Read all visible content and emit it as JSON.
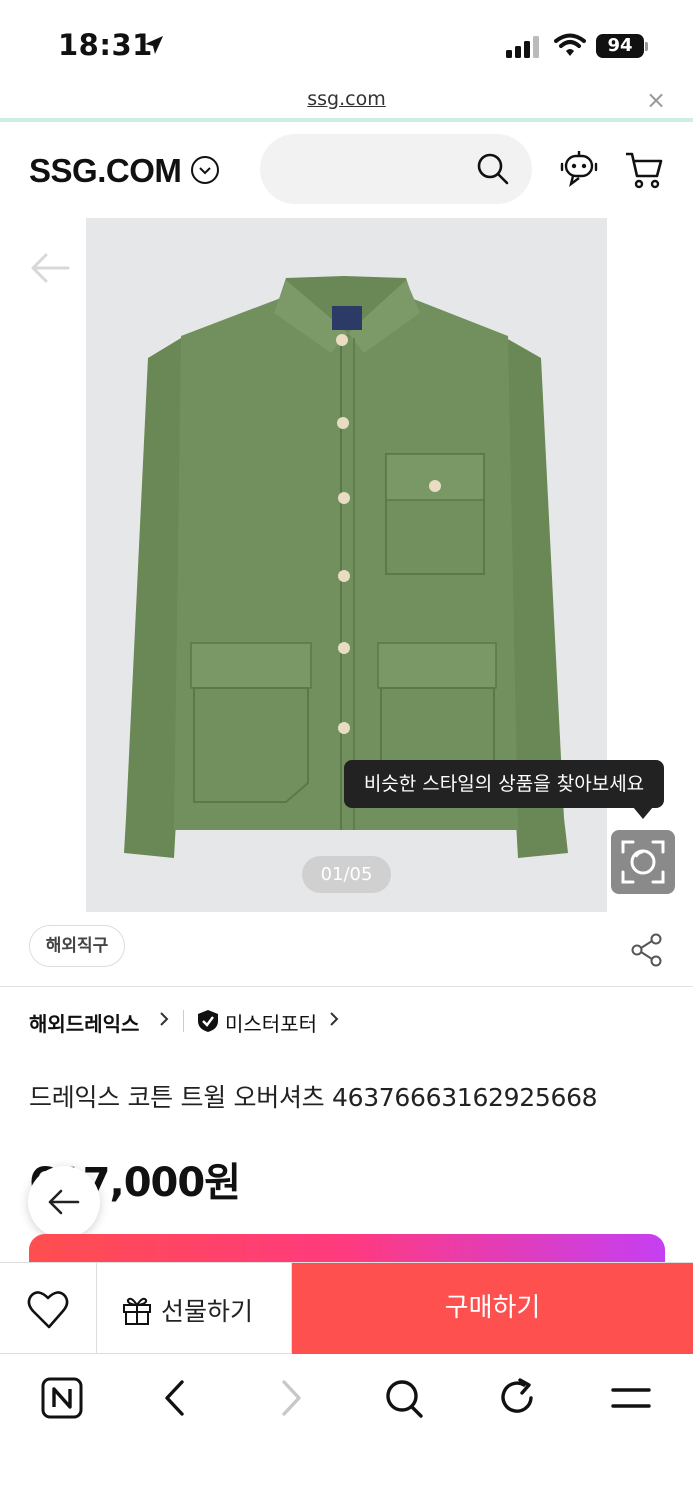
{
  "status_bar": {
    "time": "18:31",
    "battery": "94"
  },
  "browser": {
    "url": "ssg.com",
    "close_glyph": "×"
  },
  "header": {
    "logo": "SSG.COM",
    "search_placeholder": ""
  },
  "product_image": {
    "counter": "01/05",
    "tooltip": "비슷한 스타일의 상품을 찾아보세요"
  },
  "product": {
    "badge": "해외직구",
    "brand": "해외드레익스",
    "seller": "미스터포터",
    "title": "드레익스 코튼 트윌 오버셔츠 46376663162925668",
    "price": "617,000원"
  },
  "purchase_bar": {
    "gift_label": "선물하기",
    "buy_label": "구매하기"
  },
  "colors": {
    "accent": "#ff5050",
    "url_divider": "#cdeee0",
    "jacket": "#6f8c5c"
  },
  "icons": [
    "location-arrow-icon",
    "signal-icon",
    "wifi-icon",
    "battery-icon",
    "chevron-down-icon",
    "search-icon",
    "chatbot-icon",
    "cart-icon",
    "back-arrow-icon",
    "lens-search-icon",
    "share-icon",
    "shield-check-icon",
    "heart-icon",
    "gift-icon",
    "naver-icon",
    "back-icon",
    "forward-icon",
    "refresh-icon",
    "menu-icon"
  ]
}
